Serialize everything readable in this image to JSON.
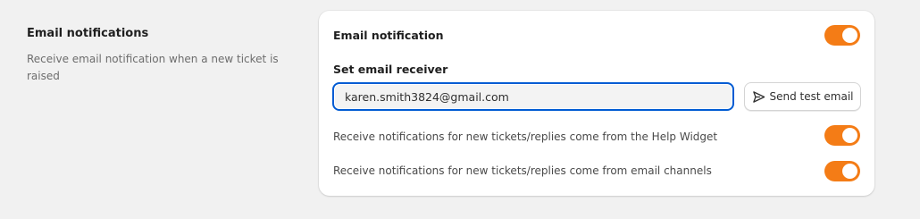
{
  "section": {
    "title": "Email notifications",
    "description": "Receive email notification when a new ticket is raised"
  },
  "card": {
    "email_notification_label": "Email notification",
    "email_notification_on": true,
    "receiver_label": "Set email receiver",
    "receiver_value": "karen.smith3824@gmail.com",
    "send_test_label": "Send test email",
    "send_icon": "send-icon",
    "options": [
      {
        "label": "Receive notifications for new tickets/replies come from the Help Widget",
        "on": true
      },
      {
        "label": "Receive notifications for new tickets/replies come from email channels",
        "on": true
      }
    ]
  },
  "colors": {
    "toggle_on": "#f47c16",
    "focus_border": "#005bd3",
    "page_bg": "#f1f1f1"
  }
}
